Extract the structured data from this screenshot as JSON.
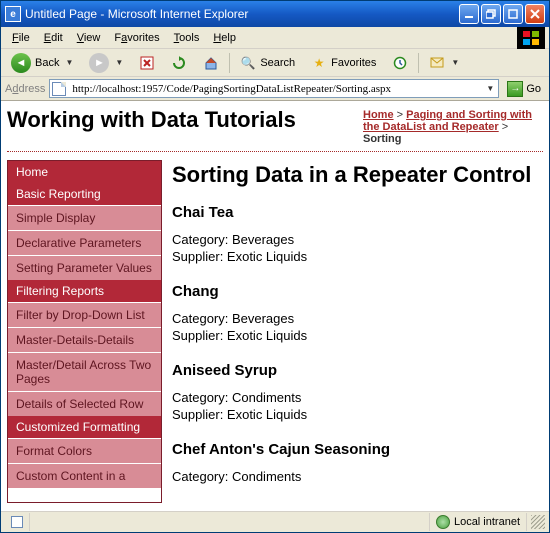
{
  "window": {
    "title": "Untitled Page - Microsoft Internet Explorer"
  },
  "menu": {
    "file": "File",
    "edit": "Edit",
    "view": "View",
    "favorites": "Favorites",
    "tools": "Tools",
    "help": "Help"
  },
  "toolbar": {
    "back": "Back",
    "search": "Search",
    "favorites": "Favorites"
  },
  "address": {
    "label": "Address",
    "value": "http://localhost:1957/Code/PagingSortingDataListRepeater/Sorting.aspx",
    "go": "Go"
  },
  "page": {
    "heading": "Working with Data Tutorials",
    "breadcrumb": {
      "home": "Home",
      "section": "Paging and Sorting with the DataList and Repeater",
      "current": "Sorting"
    },
    "content_title": "Sorting Data in a Repeater Control",
    "sidebar": {
      "sections": [
        {
          "header": "Home",
          "items": []
        },
        {
          "header": "Basic Reporting",
          "items": [
            "Simple Display",
            "Declarative Parameters",
            "Setting Parameter Values"
          ]
        },
        {
          "header": "Filtering Reports",
          "items": [
            "Filter by Drop-Down List",
            "Master-Details-Details",
            "Master/Detail Across Two Pages",
            "Details of Selected Row"
          ]
        },
        {
          "header": "Customized Formatting",
          "items": [
            "Format Colors",
            "Custom Content in a"
          ]
        }
      ]
    },
    "products": [
      {
        "name": "Chai Tea",
        "category": "Beverages",
        "supplier": "Exotic Liquids"
      },
      {
        "name": "Chang",
        "category": "Beverages",
        "supplier": "Exotic Liquids"
      },
      {
        "name": "Aniseed Syrup",
        "category": "Condiments",
        "supplier": "Exotic Liquids"
      },
      {
        "name": "Chef Anton's Cajun Seasoning",
        "category": "Condiments",
        "supplier": ""
      }
    ],
    "labels": {
      "category": "Category",
      "supplier": "Supplier"
    }
  },
  "status": {
    "zone": "Local intranet"
  }
}
